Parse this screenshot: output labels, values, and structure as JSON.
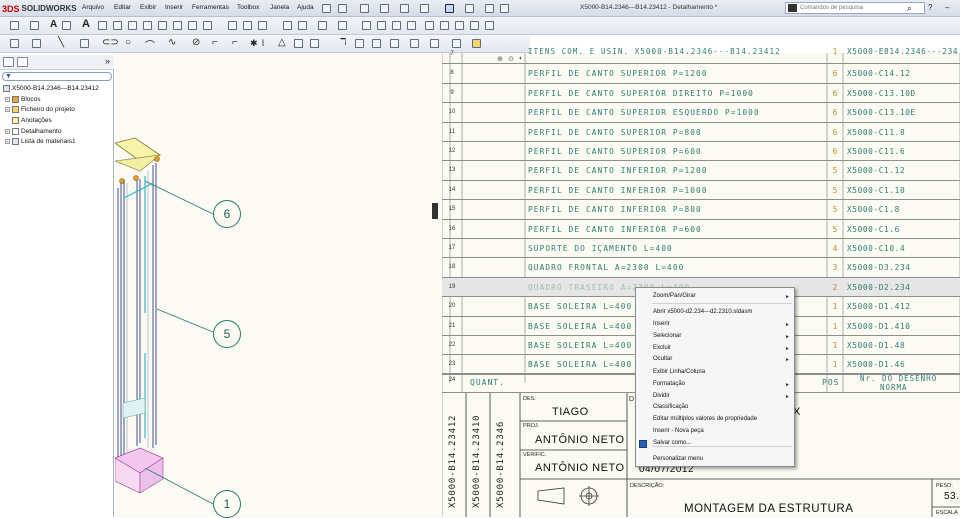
{
  "app": {
    "logo_ds": "3DS",
    "logo_text": "SOLIDWORKS",
    "window_title": "X5000-B14.2346---B14.23412 - Detalhamento *",
    "menus": [
      "Arquivo",
      "Editar",
      "Exibir",
      "Inserir",
      "Ferramentas",
      "Toolbox",
      "Janela",
      "Ajuda"
    ],
    "search_placeholder": "Comandos de pesquisa"
  },
  "feature_tree": {
    "collapse_label": "»",
    "items": [
      {
        "label": "X5000-B14.2346---B14.23412"
      },
      {
        "label": "Blocos"
      },
      {
        "label": "Ficheiro do projeto"
      },
      {
        "label": "Anotações"
      },
      {
        "label": "Detalhamento"
      },
      {
        "label": "Lista de materiais1"
      }
    ]
  },
  "balloons": [
    "6",
    "5",
    "1"
  ],
  "bom": {
    "top_row_num": "7",
    "top_row_desc": "ITENS COM. E USIN. X5000-B14.2346---B14.23412",
    "top_row_qty": "1",
    "top_row_ref": "X5000-E814.2346---234",
    "rows": [
      {
        "num": "8",
        "desc": "PERFIL DE CANTO SUPERIOR P=1200",
        "qty": "6",
        "ref": "X5000-C14.12"
      },
      {
        "num": "9",
        "desc": "PERFIL DE CANTO SUPERIOR DIREITO P=1000",
        "qty": "6",
        "ref": "X5000-C13.10D"
      },
      {
        "num": "10",
        "desc": "PERFIL DE CANTO SUPERIOR ESQUERDO P=1000",
        "qty": "6",
        "ref": "X5000-C13.10E"
      },
      {
        "num": "11",
        "desc": "PERFIL DE CANTO SUPERIOR P=800",
        "qty": "6",
        "ref": "X5000-C11.8"
      },
      {
        "num": "12",
        "desc": "PERFIL DE CANTO SUPERIOR P=600",
        "qty": "6",
        "ref": "X5000-C11.6"
      },
      {
        "num": "13",
        "desc": "PERFIL DE CANTO INFERIOR P=1200",
        "qty": "5",
        "ref": "X5000-C1.12"
      },
      {
        "num": "14",
        "desc": "PERFIL DE CANTO INFERIOR P=1000",
        "qty": "5",
        "ref": "X5000-C1.10"
      },
      {
        "num": "15",
        "desc": "PERFIL DE CANTO INFERIOR P=800",
        "qty": "5",
        "ref": "X5000-C1.8"
      },
      {
        "num": "16",
        "desc": "PERFIL DE CANTO INFERIOR P=600",
        "qty": "5",
        "ref": "X5000-C1.6"
      },
      {
        "num": "17",
        "desc": "SUPORTE DO IÇAMENTO L=400",
        "qty": "4",
        "ref": "X5000-C10.4"
      },
      {
        "num": "18",
        "desc": "QUADRO FRONTAL A=2300 L=400",
        "qty": "3",
        "ref": "X5000-D3.234"
      },
      {
        "num": "19",
        "desc": "QUADRO TRASEIRO A=2300 L=400",
        "qty": "2",
        "ref": "X5000-D2.234"
      },
      {
        "num": "20",
        "desc": "BASE SOLEIRA L=400",
        "qty": "1",
        "ref": "X5000-D1.412"
      },
      {
        "num": "21",
        "desc": "BASE SOLEIRA L=400",
        "qty": "1",
        "ref": "X5000-D1.410"
      },
      {
        "num": "22",
        "desc": "BASE SOLEIRA L=400",
        "qty": "1",
        "ref": "X5000-D1.48"
      },
      {
        "num": "23",
        "desc": "BASE SOLEIRA L=400",
        "qty": "1",
        "ref": "X5000-D1.46"
      }
    ],
    "header_num": "24",
    "header_qty": "QUANT.",
    "header_pos": "POS",
    "header_draw_line1": "Nr. DO DESENHO",
    "header_draw_line2": "NORMA"
  },
  "title_block": {
    "vertical_codes": [
      "X5000-B14.23412",
      "X5000-B14.23410",
      "X5000-B14.2346"
    ],
    "vertical_bottom": [
      "0",
      "0",
      "0"
    ],
    "des_label": "DES.",
    "des_value": "TIAGO",
    "proj_label": "PROJ.",
    "proj_value": "ANTÔNIO NETO",
    "verif_label": "VERIFIC.",
    "verif_value": "ANTÔNIO NETO",
    "date_value": "04/07/2012",
    "desc_label": "DESCRIÇÃO:",
    "desc_value": "MONTAGEM DA ESTRUTURA",
    "peso_label": "PESO:",
    "peso_value": "53.",
    "escala_label": "ESCALA",
    "d_letter": "D",
    "x_letter": "X"
  },
  "context_menu": {
    "items": [
      {
        "label": "Zoom/Pan/Girar",
        "submenu": true
      },
      {
        "label": "Abrir x5000-d2.234---d2.2310.sldasm",
        "submenu": false
      },
      {
        "label": "Inserir",
        "submenu": true
      },
      {
        "label": "Selecionar",
        "submenu": true
      },
      {
        "label": "Excluir",
        "submenu": true
      },
      {
        "label": "Ocultar",
        "submenu": true
      },
      {
        "label": "Exibir Linha/Coluna",
        "submenu": false
      },
      {
        "label": "Formatação",
        "submenu": true
      },
      {
        "label": "Dividir",
        "submenu": true
      },
      {
        "label": "Classificação",
        "submenu": false
      },
      {
        "label": "Editar múltiplos valores de propriedade",
        "submenu": false
      },
      {
        "label": "Inserir - Nova peça",
        "submenu": false
      },
      {
        "label": "Salvar como...",
        "submenu": false
      },
      {
        "label": "Personalizar menu",
        "submenu": false
      }
    ]
  },
  "colors": {
    "bom_text": "#2f7d6e",
    "qty_text": "#c28a26",
    "sheet_bg": "#fbfbf3"
  }
}
